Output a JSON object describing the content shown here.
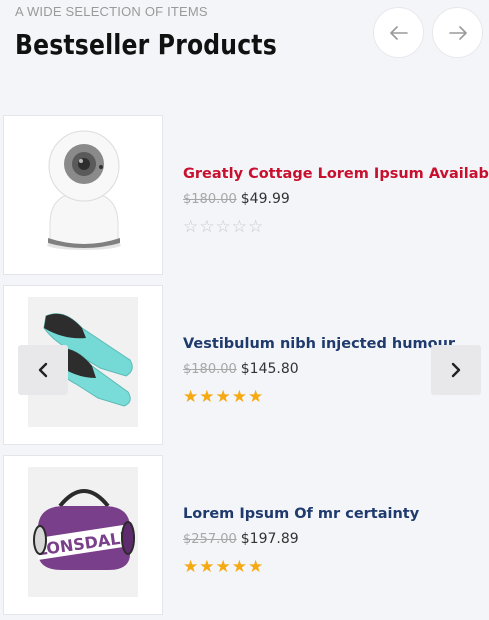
{
  "header": {
    "kicker": "A WIDE SELECTION OF ITEMS",
    "title": "Bestseller Products"
  },
  "icons": {
    "prev": "arrow-left-icon",
    "next": "arrow-right-icon",
    "slide_prev": "chevron-left-icon",
    "slide_next": "chevron-right-icon"
  },
  "products": [
    {
      "name": "Greatly Cottage Lorem Ipsum Available",
      "old_price": "$180.00",
      "price": "$49.99",
      "rating": 0,
      "image": "security-camera",
      "name_color": "#c8102e"
    },
    {
      "name": "Vestibulum nibh injected humour",
      "old_price": "$180.00",
      "price": "$145.80",
      "rating": 5,
      "image": "swim-fins",
      "name_color": "#1f3a6d"
    },
    {
      "name": "Lorem Ipsum Of mr certainty",
      "old_price": "$257.00",
      "price": "$197.89",
      "rating": 5,
      "image": "duffel-bag",
      "name_color": "#1f3a6d"
    }
  ],
  "colors": {
    "star_filled": "#f5a913",
    "star_empty": "#c9c9c9",
    "background": "#f4f5f9"
  }
}
